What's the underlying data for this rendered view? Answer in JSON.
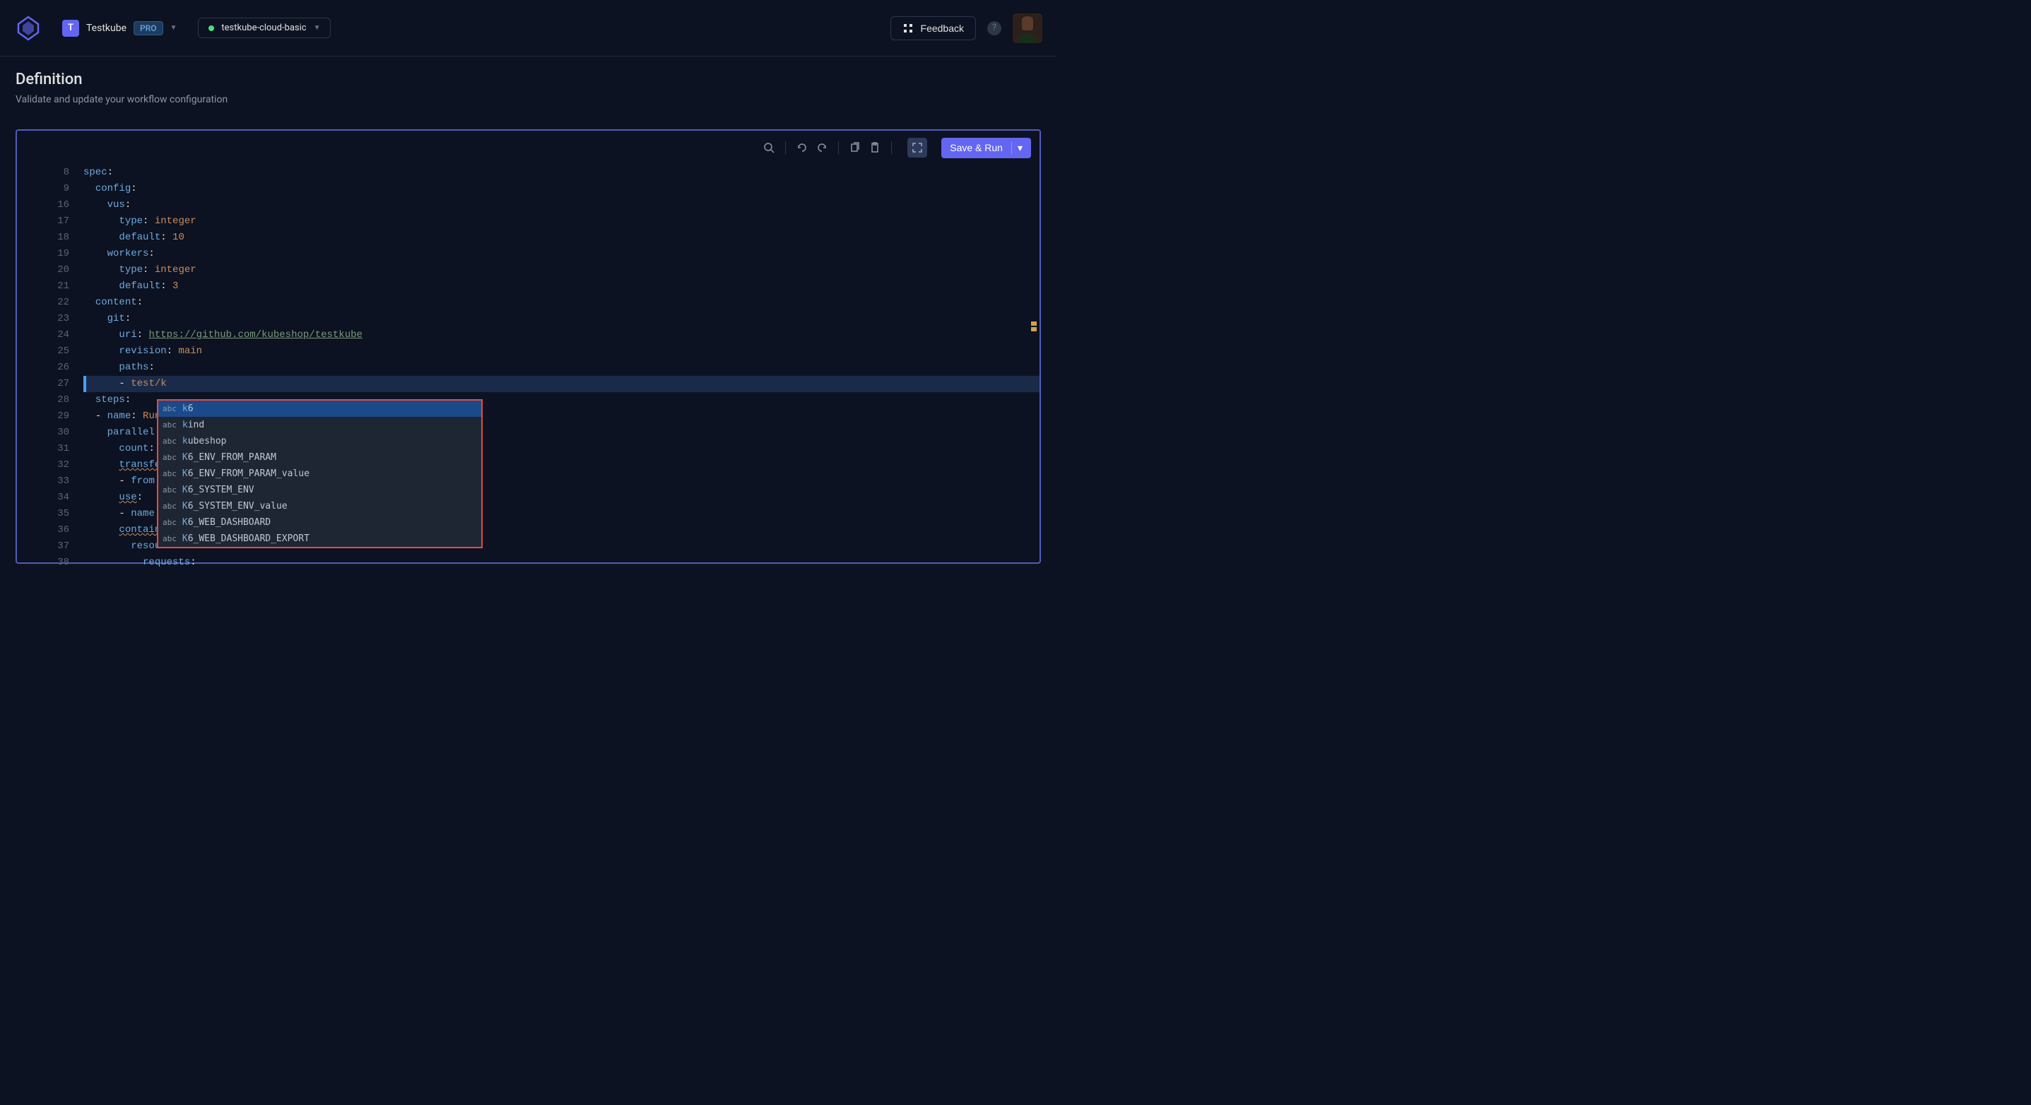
{
  "header": {
    "org_initial": "T",
    "org_name": "Testkube",
    "pro_label": "PRO",
    "env_name": "testkube-cloud-basic",
    "feedback_label": "Feedback"
  },
  "page": {
    "title": "Definition",
    "subtitle": "Validate and update your workflow configuration"
  },
  "toolbar": {
    "save_run_label": "Save & Run"
  },
  "code": {
    "lines": [
      {
        "n": 8,
        "indent": 0,
        "tokens": [
          {
            "t": "spec",
            "c": "k"
          },
          {
            "t": ":",
            "c": ""
          }
        ]
      },
      {
        "n": 9,
        "indent": 1,
        "tokens": [
          {
            "t": "config",
            "c": "k"
          },
          {
            "t": ":",
            "c": ""
          }
        ]
      },
      {
        "n": 16,
        "indent": 2,
        "tokens": [
          {
            "t": "vus",
            "c": "k"
          },
          {
            "t": ":",
            "c": ""
          }
        ]
      },
      {
        "n": 17,
        "indent": 3,
        "tokens": [
          {
            "t": "type",
            "c": "k"
          },
          {
            "t": ": ",
            "c": ""
          },
          {
            "t": "integer",
            "c": "s"
          }
        ]
      },
      {
        "n": 18,
        "indent": 3,
        "tokens": [
          {
            "t": "default",
            "c": "k"
          },
          {
            "t": ": ",
            "c": ""
          },
          {
            "t": "10",
            "c": "n"
          }
        ]
      },
      {
        "n": 19,
        "indent": 2,
        "tokens": [
          {
            "t": "workers",
            "c": "k"
          },
          {
            "t": ":",
            "c": ""
          }
        ]
      },
      {
        "n": 20,
        "indent": 3,
        "tokens": [
          {
            "t": "type",
            "c": "k"
          },
          {
            "t": ": ",
            "c": ""
          },
          {
            "t": "integer",
            "c": "s"
          }
        ]
      },
      {
        "n": 21,
        "indent": 3,
        "tokens": [
          {
            "t": "default",
            "c": "k"
          },
          {
            "t": ": ",
            "c": ""
          },
          {
            "t": "3",
            "c": "n"
          }
        ]
      },
      {
        "n": 22,
        "indent": 1,
        "tokens": [
          {
            "t": "content",
            "c": "k"
          },
          {
            "t": ":",
            "c": ""
          }
        ]
      },
      {
        "n": 23,
        "indent": 2,
        "tokens": [
          {
            "t": "git",
            "c": "k"
          },
          {
            "t": ":",
            "c": ""
          }
        ]
      },
      {
        "n": 24,
        "indent": 3,
        "tokens": [
          {
            "t": "uri",
            "c": "k"
          },
          {
            "t": ": ",
            "c": ""
          },
          {
            "t": "https://github.com/kubeshop/testkube",
            "c": "u"
          }
        ]
      },
      {
        "n": 25,
        "indent": 3,
        "tokens": [
          {
            "t": "revision",
            "c": "k"
          },
          {
            "t": ": ",
            "c": ""
          },
          {
            "t": "main",
            "c": "s"
          }
        ]
      },
      {
        "n": 26,
        "indent": 3,
        "tokens": [
          {
            "t": "paths",
            "c": "k"
          },
          {
            "t": ":",
            "c": ""
          }
        ]
      },
      {
        "n": 27,
        "indent": 3,
        "hl": true,
        "tokens": [
          {
            "t": "- ",
            "c": ""
          },
          {
            "t": "test/k",
            "c": "s"
          }
        ]
      },
      {
        "n": 28,
        "indent": 1,
        "tokens": [
          {
            "t": "steps",
            "c": "k"
          },
          {
            "t": ":",
            "c": ""
          }
        ]
      },
      {
        "n": 29,
        "indent": 1,
        "tokens": [
          {
            "t": "- ",
            "c": ""
          },
          {
            "t": "name",
            "c": "k"
          },
          {
            "t": ": ",
            "c": ""
          },
          {
            "t": "Run",
            "c": "s"
          }
        ]
      },
      {
        "n": 30,
        "indent": 2,
        "tokens": [
          {
            "t": "parallel",
            "c": "k"
          },
          {
            "t": ":",
            "c": ""
          }
        ]
      },
      {
        "n": 31,
        "indent": 3,
        "tokens": [
          {
            "t": "count",
            "c": "k"
          },
          {
            "t": ": c",
            "c": ""
          }
        ]
      },
      {
        "n": 32,
        "indent": 3,
        "tokens": [
          {
            "t": "transfe",
            "c": "k squiggle"
          }
        ]
      },
      {
        "n": 33,
        "indent": 3,
        "tokens": [
          {
            "t": "- ",
            "c": ""
          },
          {
            "t": "from",
            "c": "k"
          },
          {
            "t": ":",
            "c": ""
          }
        ]
      },
      {
        "n": 34,
        "indent": 3,
        "tokens": [
          {
            "t": "use",
            "c": "k squiggle"
          },
          {
            "t": ":",
            "c": ""
          }
        ]
      },
      {
        "n": 35,
        "indent": 3,
        "tokens": [
          {
            "t": "- ",
            "c": ""
          },
          {
            "t": "name",
            "c": "k"
          },
          {
            "t": ":",
            "c": ""
          }
        ]
      },
      {
        "n": 36,
        "indent": 3,
        "tokens": [
          {
            "t": "containe",
            "c": "k squiggle"
          }
        ]
      },
      {
        "n": 37,
        "indent": 4,
        "tokens": [
          {
            "t": "resources",
            "c": "k"
          },
          {
            "t": ":",
            "c": ""
          }
        ]
      },
      {
        "n": 38,
        "indent": 5,
        "tokens": [
          {
            "t": "requests",
            "c": "k"
          },
          {
            "t": ":",
            "c": ""
          }
        ]
      }
    ]
  },
  "autocomplete": {
    "items": [
      {
        "kind": "abc",
        "match": "k",
        "rest": "6",
        "selected": true
      },
      {
        "kind": "abc",
        "match": "k",
        "rest": "ind"
      },
      {
        "kind": "abc",
        "match": "k",
        "rest": "ubeshop"
      },
      {
        "kind": "abc",
        "match": "K",
        "rest": "6_ENV_FROM_PARAM"
      },
      {
        "kind": "abc",
        "match": "K",
        "rest": "6_ENV_FROM_PARAM_value"
      },
      {
        "kind": "abc",
        "match": "K",
        "rest": "6_SYSTEM_ENV"
      },
      {
        "kind": "abc",
        "match": "K",
        "rest": "6_SYSTEM_ENV_value"
      },
      {
        "kind": "abc",
        "match": "K",
        "rest": "6_WEB_DASHBOARD"
      },
      {
        "kind": "abc",
        "match": "K",
        "rest": "6_WEB_DASHBOARD_EXPORT"
      }
    ]
  }
}
